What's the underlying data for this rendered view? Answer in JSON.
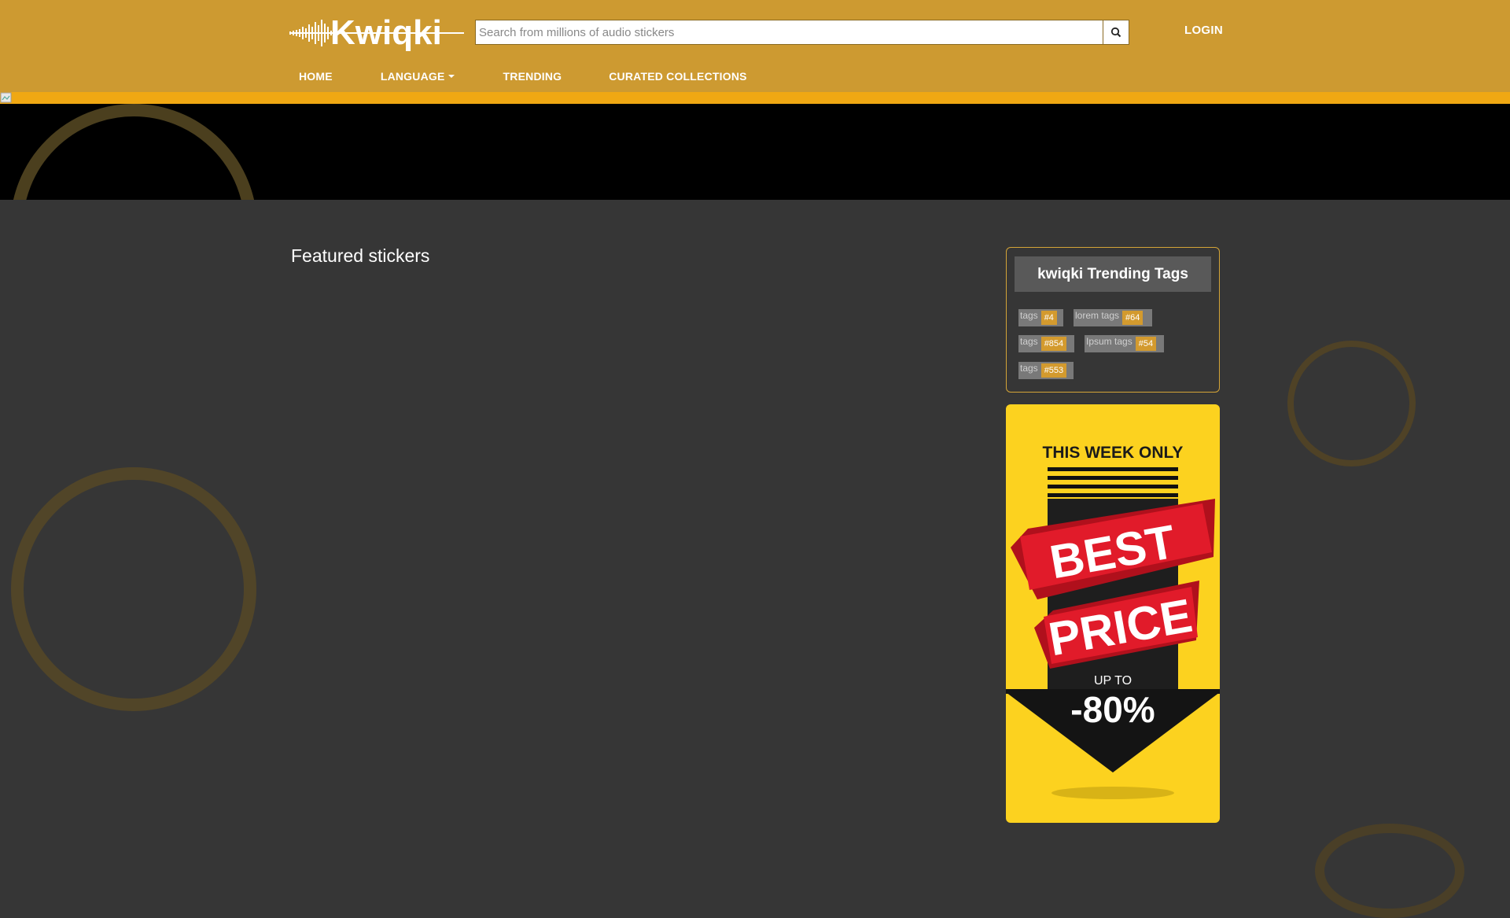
{
  "header": {
    "logo_text": "Kwiqki",
    "search_placeholder": "Search from millions of audio stickers",
    "search_icon": "search-icon",
    "login_label": "LOGIN",
    "background_color": "#cd9a31"
  },
  "nav": {
    "items": [
      {
        "label": "HOME"
      },
      {
        "label": "LANGUAGE",
        "has_dropdown": true
      },
      {
        "label": "TRENDING"
      },
      {
        "label": "CURATED COLLECTIONS"
      }
    ]
  },
  "main": {
    "featured_title": "Featured stickers"
  },
  "trending_tags": {
    "title": "kwiqki Trending Tags",
    "tags": [
      {
        "label": "tags",
        "count": "#4"
      },
      {
        "label": "lorem tags",
        "count": "#64"
      },
      {
        "label": "tags",
        "count": "#854"
      },
      {
        "label": "Ipsum tags",
        "count": "#54"
      },
      {
        "label": "tags",
        "count": "#553"
      }
    ]
  },
  "promo": {
    "line1": "THIS WEEK ONLY",
    "line2": "BEST",
    "line3": "PRICE",
    "line4": "UP TO",
    "line5": "-80%",
    "background_color": "#fcd21f"
  },
  "colors": {
    "accent": "#f0a813",
    "page_background": "#363636",
    "tag_count": "#d39a2e"
  }
}
